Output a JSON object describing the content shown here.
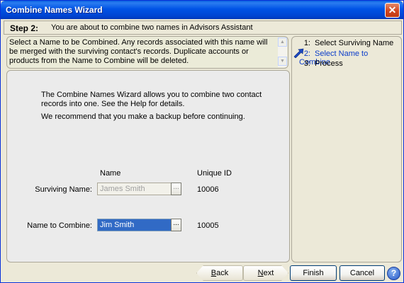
{
  "window": {
    "title": "Combine Names Wizard",
    "close_glyph": "✕"
  },
  "step_header": {
    "label": "Step 2:",
    "description": "You are about to combine two names in Advisors Assistant"
  },
  "info": {
    "text": "Select a Name to be Combined.  Any records associated with this name will be merged with the surviving contact's records.  Duplicate accounts or products from the Name to Combine will be deleted."
  },
  "main": {
    "para1": "The Combine Names Wizard allows you to combine two contact records into one.  See the Help for details.",
    "para2": "We recommend that you make a backup before continuing.",
    "col_name": "Name",
    "col_id": "Unique ID",
    "surviving_label": "Surviving Name:",
    "surviving_value": "James Smith",
    "surviving_id": "10006",
    "combine_label": "Name to Combine:",
    "combine_value": "Jim Smith",
    "combine_id": "10005",
    "ellipsis": "..."
  },
  "steps": [
    {
      "num": "1:",
      "label": "Select Surviving Name"
    },
    {
      "num": "2:",
      "label": "Select Name to Combine"
    },
    {
      "num": "3:",
      "label": "Process"
    }
  ],
  "buttons": {
    "back": "Back",
    "next": "Next",
    "finish": "Finish",
    "cancel": "Cancel",
    "help": "?"
  },
  "colors": {
    "titlebar": "#0053e6",
    "active_step": "#0b3cc9",
    "selection": "#316ac5"
  },
  "icons": [
    "close-icon",
    "scroll-up-icon",
    "scroll-down-icon",
    "current-step-arrow-icon",
    "help-icon"
  ]
}
